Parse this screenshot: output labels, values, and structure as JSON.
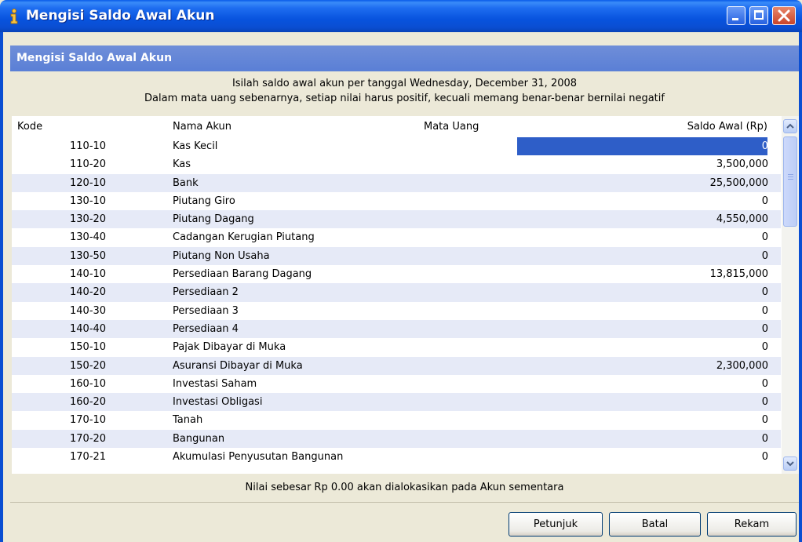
{
  "window": {
    "title": "Mengisi Saldo Awal Akun"
  },
  "panel": {
    "header": "Mengisi Saldo Awal Akun",
    "instruction_line1": "Isilah saldo awal akun per tanggal Wednesday, December 31, 2008",
    "instruction_line2": "Dalam mata uang sebenarnya, setiap nilai harus positif, kecuali memang benar-benar bernilai negatif"
  },
  "table": {
    "columns": {
      "kode": "Kode",
      "nama": "Nama Akun",
      "mata_uang": "Mata Uang",
      "saldo": "Saldo Awal (Rp)"
    },
    "rows": [
      {
        "kode": "110-10",
        "nama": "Kas Kecil",
        "mata_uang": "",
        "saldo": "0"
      },
      {
        "kode": "110-20",
        "nama": "Kas",
        "mata_uang": "",
        "saldo": "3,500,000"
      },
      {
        "kode": "120-10",
        "nama": "Bank",
        "mata_uang": "",
        "saldo": "25,500,000"
      },
      {
        "kode": "130-10",
        "nama": "Piutang Giro",
        "mata_uang": "",
        "saldo": "0"
      },
      {
        "kode": "130-20",
        "nama": "Piutang Dagang",
        "mata_uang": "",
        "saldo": "4,550,000"
      },
      {
        "kode": "130-40",
        "nama": "Cadangan Kerugian Piutang",
        "mata_uang": "",
        "saldo": "0"
      },
      {
        "kode": "130-50",
        "nama": "Piutang Non Usaha",
        "mata_uang": "",
        "saldo": "0"
      },
      {
        "kode": "140-10",
        "nama": "Persediaan Barang Dagang",
        "mata_uang": "",
        "saldo": "13,815,000"
      },
      {
        "kode": "140-20",
        "nama": "Persediaan 2",
        "mata_uang": "",
        "saldo": "0"
      },
      {
        "kode": "140-30",
        "nama": "Persediaan 3",
        "mata_uang": "",
        "saldo": "0"
      },
      {
        "kode": "140-40",
        "nama": "Persediaan 4",
        "mata_uang": "",
        "saldo": "0"
      },
      {
        "kode": "150-10",
        "nama": "Pajak Dibayar di Muka",
        "mata_uang": "",
        "saldo": "0"
      },
      {
        "kode": "150-20",
        "nama": "Asuransi Dibayar di Muka",
        "mata_uang": "",
        "saldo": "2,300,000"
      },
      {
        "kode": "160-10",
        "nama": "Investasi Saham",
        "mata_uang": "",
        "saldo": "0"
      },
      {
        "kode": "160-20",
        "nama": "Investasi Obligasi",
        "mata_uang": "",
        "saldo": "0"
      },
      {
        "kode": "170-10",
        "nama": "Tanah",
        "mata_uang": "",
        "saldo": "0"
      },
      {
        "kode": "170-20",
        "nama": "Bangunan",
        "mata_uang": "",
        "saldo": "0"
      },
      {
        "kode": "170-21",
        "nama": "Akumulasi Penyusutan Bangunan",
        "mata_uang": "",
        "saldo": "0"
      }
    ]
  },
  "footnote": "Nilai sebesar Rp 0.00 akan dialokasikan pada Akun sementara",
  "buttons": {
    "petunjuk": "Petunjuk",
    "batal": "Batal",
    "rekam": "Rekam"
  },
  "colors": {
    "title_bar": "#0a4ed2",
    "header_band": "#6481d6",
    "alt_row": "#e6eaf7",
    "selection": "#2e5ec8",
    "close_button": "#d85a3c"
  },
  "icons": {
    "window_icon": "info-icon",
    "minimize": "minimize-icon",
    "maximize": "maximize-icon",
    "close": "close-icon",
    "scroll_up": "chevron-up-icon",
    "scroll_down": "chevron-down-icon"
  }
}
